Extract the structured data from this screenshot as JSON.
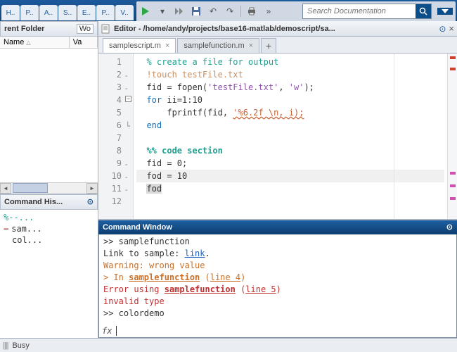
{
  "ribbon": {
    "tabs": [
      "H..",
      "P..",
      "A..",
      "S..",
      "E..",
      "P..",
      "V.."
    ],
    "search_placeholder": "Search Documentation"
  },
  "left": {
    "folder_title": "rent Folder",
    "workspace_tab": "Wo",
    "col_name": "Name",
    "col_value": "Va",
    "history_title": "Command His...",
    "history": {
      "comment": "%--...",
      "item1": "sam...",
      "item2": "col..."
    }
  },
  "editor": {
    "title": "Editor - /home/andy/projects/base16-matlab/demoscript/sa...",
    "tabs": {
      "active": "samplescript.m",
      "inactive": "samplefunction.m"
    },
    "lines": {
      "l1_a": "% create a file for output",
      "l2_a": "!touch testFile.txt",
      "l3_a": "fid = fopen(",
      "l3_b": "'testFile.txt'",
      "l3_c": ", ",
      "l3_d": "'w'",
      "l3_e": ");",
      "l4_a": "for",
      "l4_b": " ii=1:10",
      "l5_a": "    fprintf(fid, ",
      "l5_b": "'%6.2f \\n, i);",
      "l6_a": "end",
      "l8_a": "%% code section",
      "l9_a": "fid = 0;",
      "l10_a": "fod = 10",
      "l11_a": "fod"
    },
    "nums": [
      "1",
      "2",
      "3",
      "4",
      "5",
      "6",
      "7",
      "8",
      "9",
      "10",
      "11",
      "12"
    ]
  },
  "cmd": {
    "title": "Command Window",
    "l1_a": ">> samplefunction",
    "l2_a": "Link to sample: ",
    "l2_b": "link",
    "l2_c": ".",
    "l3_a": "Warning: wrong value",
    "l4_a": "> In ",
    "l4_b": "samplefunction",
    "l4_c": " (",
    "l4_d": "line 4",
    "l4_e": ")",
    "l5_a": "Error using ",
    "l5_b": "samplefunction",
    "l5_c": " (",
    "l5_d": "line 5",
    "l5_e": ")",
    "l6_a": "invalid type",
    "l7_a": ">> colordemo",
    "prompt": "fx"
  },
  "status": {
    "busy": "Busy"
  }
}
